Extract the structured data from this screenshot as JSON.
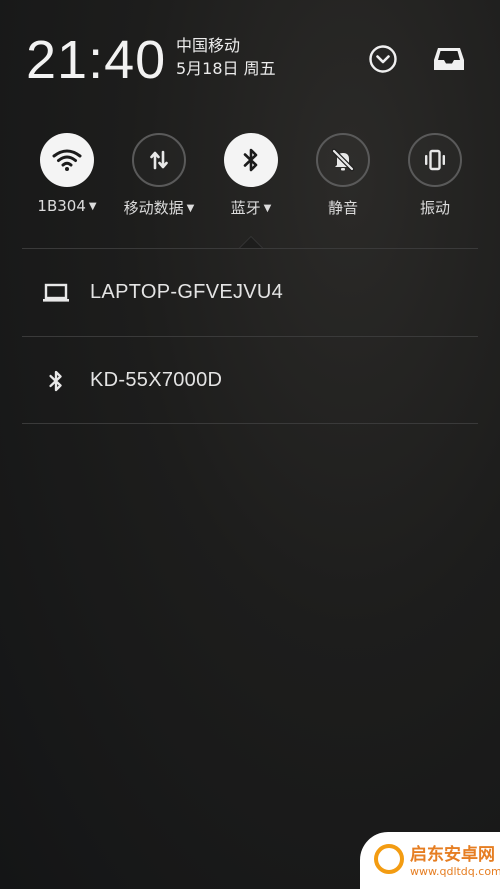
{
  "status": {
    "time": "21:40",
    "carrier": "中国移动",
    "date": "5月18日 周五"
  },
  "icons": {
    "expand": "chevron-down-circle-icon",
    "inbox": "inbox-tray-icon"
  },
  "toggles": [
    {
      "id": "wifi",
      "label": "1B304",
      "icon": "wifi-icon",
      "active": true,
      "has_menu": true
    },
    {
      "id": "mobile-data",
      "label": "移动数据",
      "icon": "data-arrows-icon",
      "active": false,
      "has_menu": true
    },
    {
      "id": "bluetooth",
      "label": "蓝牙",
      "icon": "bluetooth-icon",
      "active": true,
      "has_menu": true
    },
    {
      "id": "silent",
      "label": "静音",
      "icon": "bell-off-icon",
      "active": false,
      "has_menu": false
    },
    {
      "id": "vibrate",
      "label": "振动",
      "icon": "vibrate-icon",
      "active": false,
      "has_menu": false
    }
  ],
  "devices": [
    {
      "name": "LAPTOP-GFVEJVU4",
      "icon": "laptop-icon"
    },
    {
      "name": "KD-55X7000D",
      "icon": "bluetooth-icon"
    }
  ],
  "watermark": {
    "title": "启东安卓网",
    "url": "www.qdltdq.com"
  },
  "colors": {
    "active_toggle": "#f4f4f4",
    "inactive_ring": "#5a5a5a",
    "divider": "#3a3a3a",
    "watermark_accent": "#e67e22"
  }
}
